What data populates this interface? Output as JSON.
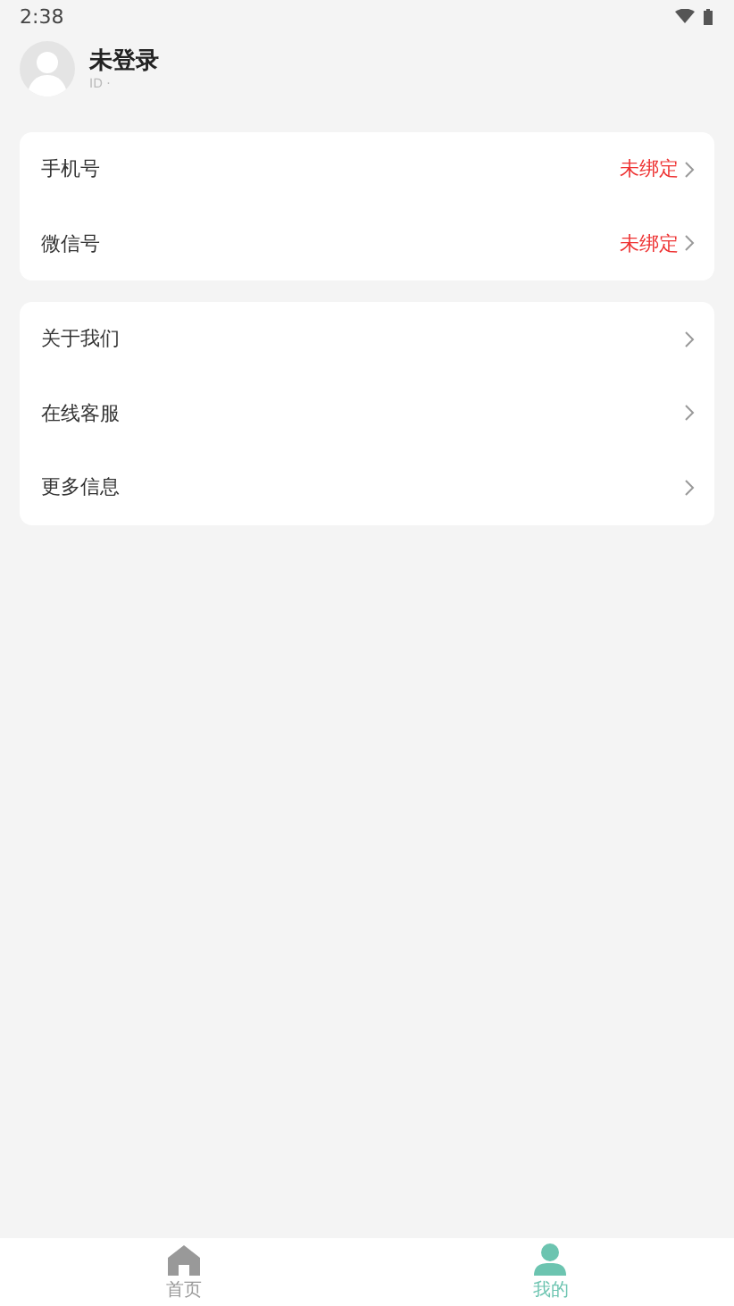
{
  "status_bar": {
    "time": "2:38"
  },
  "profile": {
    "name": "未登录",
    "id_label": "ID ·"
  },
  "account_section": [
    {
      "label": "手机号",
      "value": "未绑定"
    },
    {
      "label": "微信号",
      "value": "未绑定"
    }
  ],
  "info_section": [
    {
      "label": "关于我们"
    },
    {
      "label": "在线客服"
    },
    {
      "label": "更多信息"
    }
  ],
  "tab_bar": [
    {
      "label": "首页",
      "kind": "home",
      "selected": false
    },
    {
      "label": "我的",
      "kind": "profile",
      "selected": true
    }
  ]
}
